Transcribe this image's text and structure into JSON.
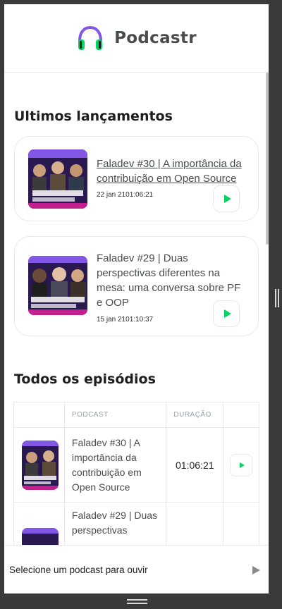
{
  "app": {
    "title": "Podcastr",
    "accent": "#04d361",
    "logo_color": "#8257e5"
  },
  "latest": {
    "heading": "Ultimos lançamentos",
    "episodes": [
      {
        "title": "Faladev #30 | A importância da contribuição em Open Source",
        "date": "22 jan 2101:06:21"
      },
      {
        "title": "Faladev #29 | Duas perspectivas diferentes na mesa: uma conversa sobre PF e OOP",
        "date": "15 jan 2101:10:37"
      }
    ]
  },
  "all": {
    "heading": "Todos os episódios",
    "columns": [
      "",
      "PODCAST",
      "DURAÇÃO",
      ""
    ],
    "rows": [
      {
        "title": "Faladev #30 | A importância da contribuição em Open Source",
        "duration": "01:06:21"
      },
      {
        "title": "Faladev #29 | Duas perspectivas",
        "duration": ""
      }
    ]
  },
  "player": {
    "status": "Selecione um podcast para ouvir"
  }
}
